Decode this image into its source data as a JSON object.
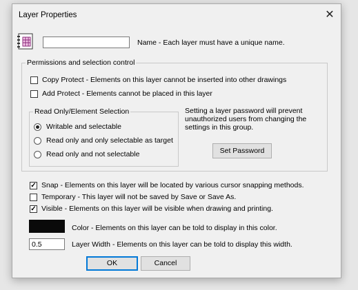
{
  "window": {
    "title": "Layer Properties",
    "close_glyph": "✕"
  },
  "name_row": {
    "icon": "layer-properties-icon",
    "value": "",
    "label": "Name - Each layer must have a unique name."
  },
  "permissions": {
    "label": "Permissions and selection control",
    "copy_protect": {
      "checked": false,
      "label": "Copy Protect - Elements on this layer cannot be inserted into other drawings"
    },
    "add_protect": {
      "checked": false,
      "label": "Add Protect - Elements cannot be placed in this layer"
    },
    "read_only": {
      "label": "Read Only/Element Selection",
      "options": [
        {
          "label": "Writable and selectable",
          "selected": true
        },
        {
          "label": "Read only and only selectable as target",
          "selected": false
        },
        {
          "label": "Read only and not selectable",
          "selected": false
        }
      ]
    },
    "password_note": "Setting a layer password will prevent unauthorized users from changing the settings in this group.",
    "set_password": "Set Password"
  },
  "snap": {
    "checked": true,
    "label": "Snap - Elements on this layer will be located by various cursor snapping methods."
  },
  "temporary": {
    "checked": false,
    "label": "Temporary - This layer will not be saved by Save or Save As."
  },
  "visible": {
    "checked": true,
    "label": "Visible - Elements on this layer will be visible when drawing and printing."
  },
  "color": {
    "value": "#0a0a0a",
    "label": "Color - Elements on this layer can be told to display in this color."
  },
  "width": {
    "value": "0.5",
    "label": "Layer Width - Elements on this layer can be told to display this width."
  },
  "buttons": {
    "ok": "OK",
    "cancel": "Cancel"
  }
}
